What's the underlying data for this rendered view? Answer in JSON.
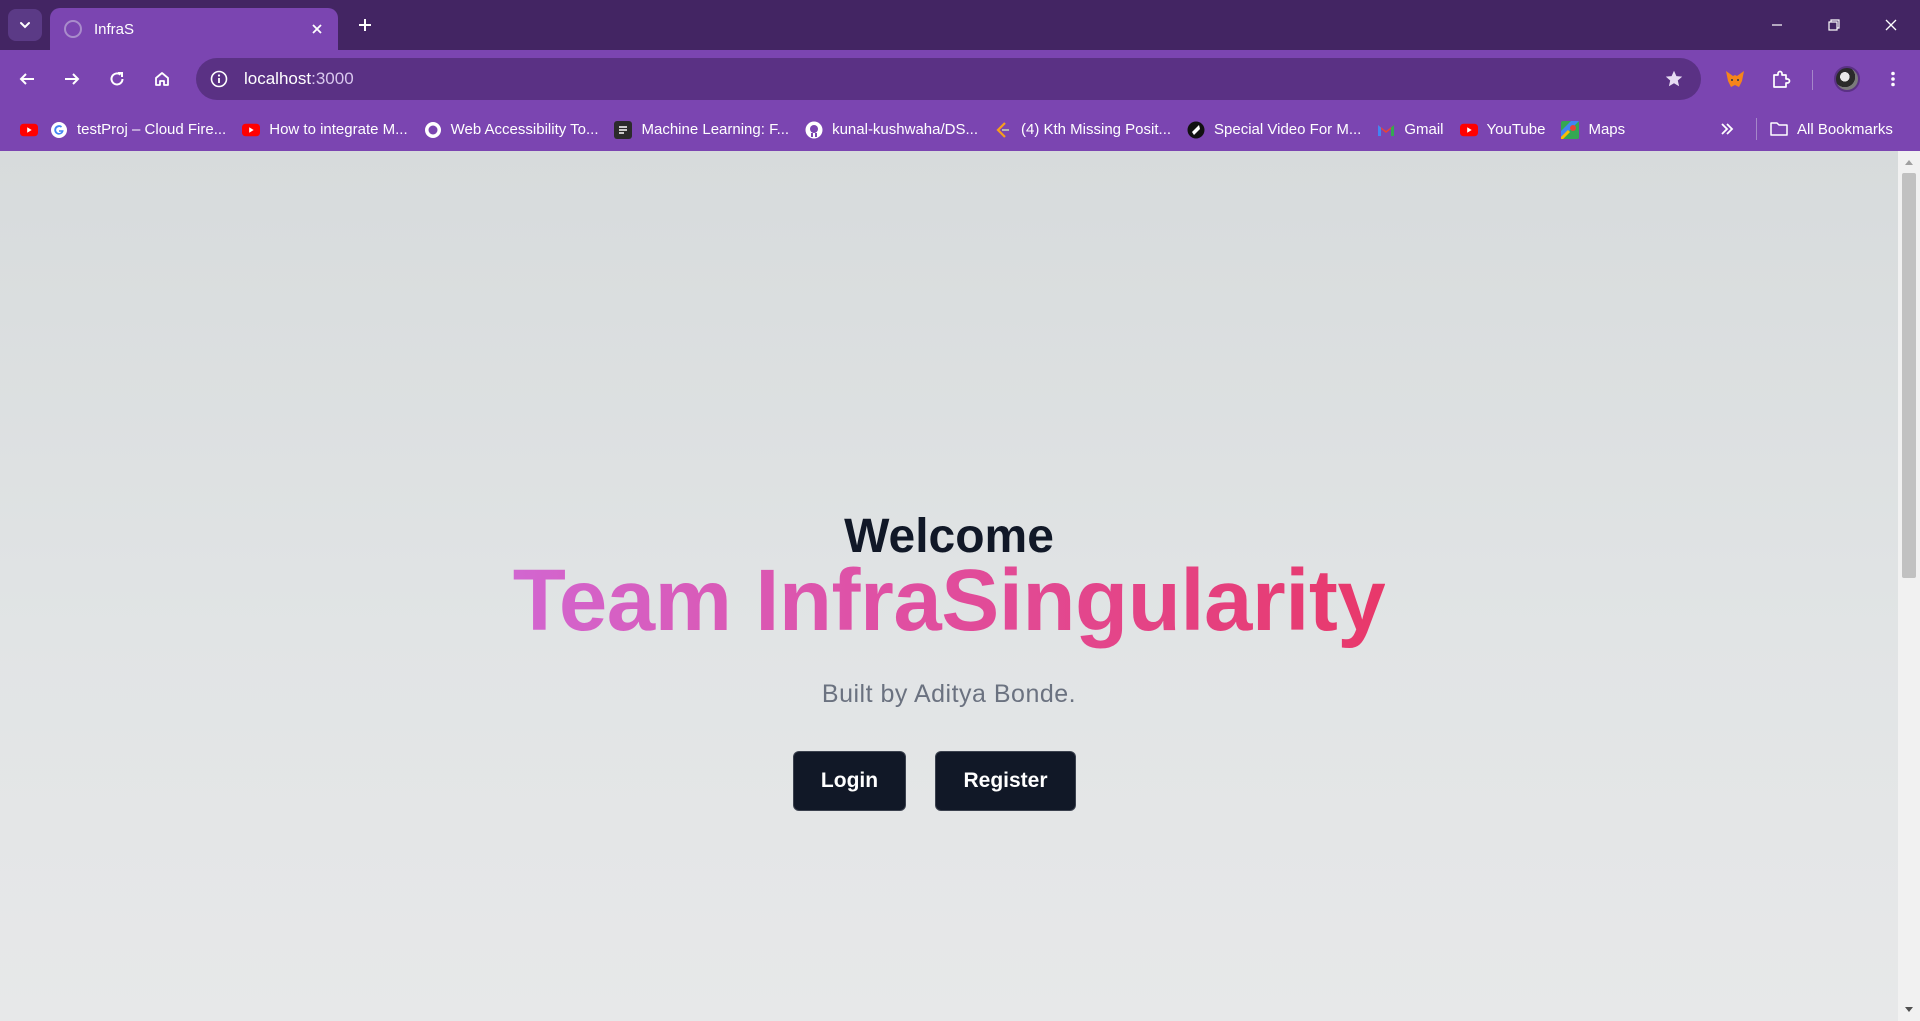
{
  "browser": {
    "tab": {
      "title": "InfraS"
    },
    "address": {
      "host": "localhost",
      "port": ":3000"
    },
    "bookmarks": [
      {
        "label": "",
        "icon": "youtube-icon"
      },
      {
        "label": "testProj – Cloud Fire...",
        "icon": "google-icon"
      },
      {
        "label": "How to integrate M...",
        "icon": "youtube-icon"
      },
      {
        "label": "Web Accessibility To...",
        "icon": "globe-icon"
      },
      {
        "label": "Machine Learning: F...",
        "icon": "notes-icon"
      },
      {
        "label": "kunal-kushwaha/DS...",
        "icon": "github-icon"
      },
      {
        "label": "(4) Kth Missing Posit...",
        "icon": "leetcode-icon"
      },
      {
        "label": "Special Video For M...",
        "icon": "video-icon"
      },
      {
        "label": "Gmail",
        "icon": "gmail-icon"
      },
      {
        "label": "YouTube",
        "icon": "youtube-icon"
      },
      {
        "label": "Maps",
        "icon": "maps-icon"
      }
    ],
    "all_bookmarks_label": "All Bookmarks"
  },
  "page": {
    "welcome": "Welcome",
    "brand": "Team InfraSingularity",
    "byline": "Built by Aditya Bonde.",
    "login_label": "Login",
    "register_label": "Register"
  },
  "colors": {
    "frame": "#432563",
    "toolbar": "#7b45b1",
    "gradient_start": "#d266d0",
    "gradient_end": "#e8386a",
    "button_bg": "#111827"
  }
}
